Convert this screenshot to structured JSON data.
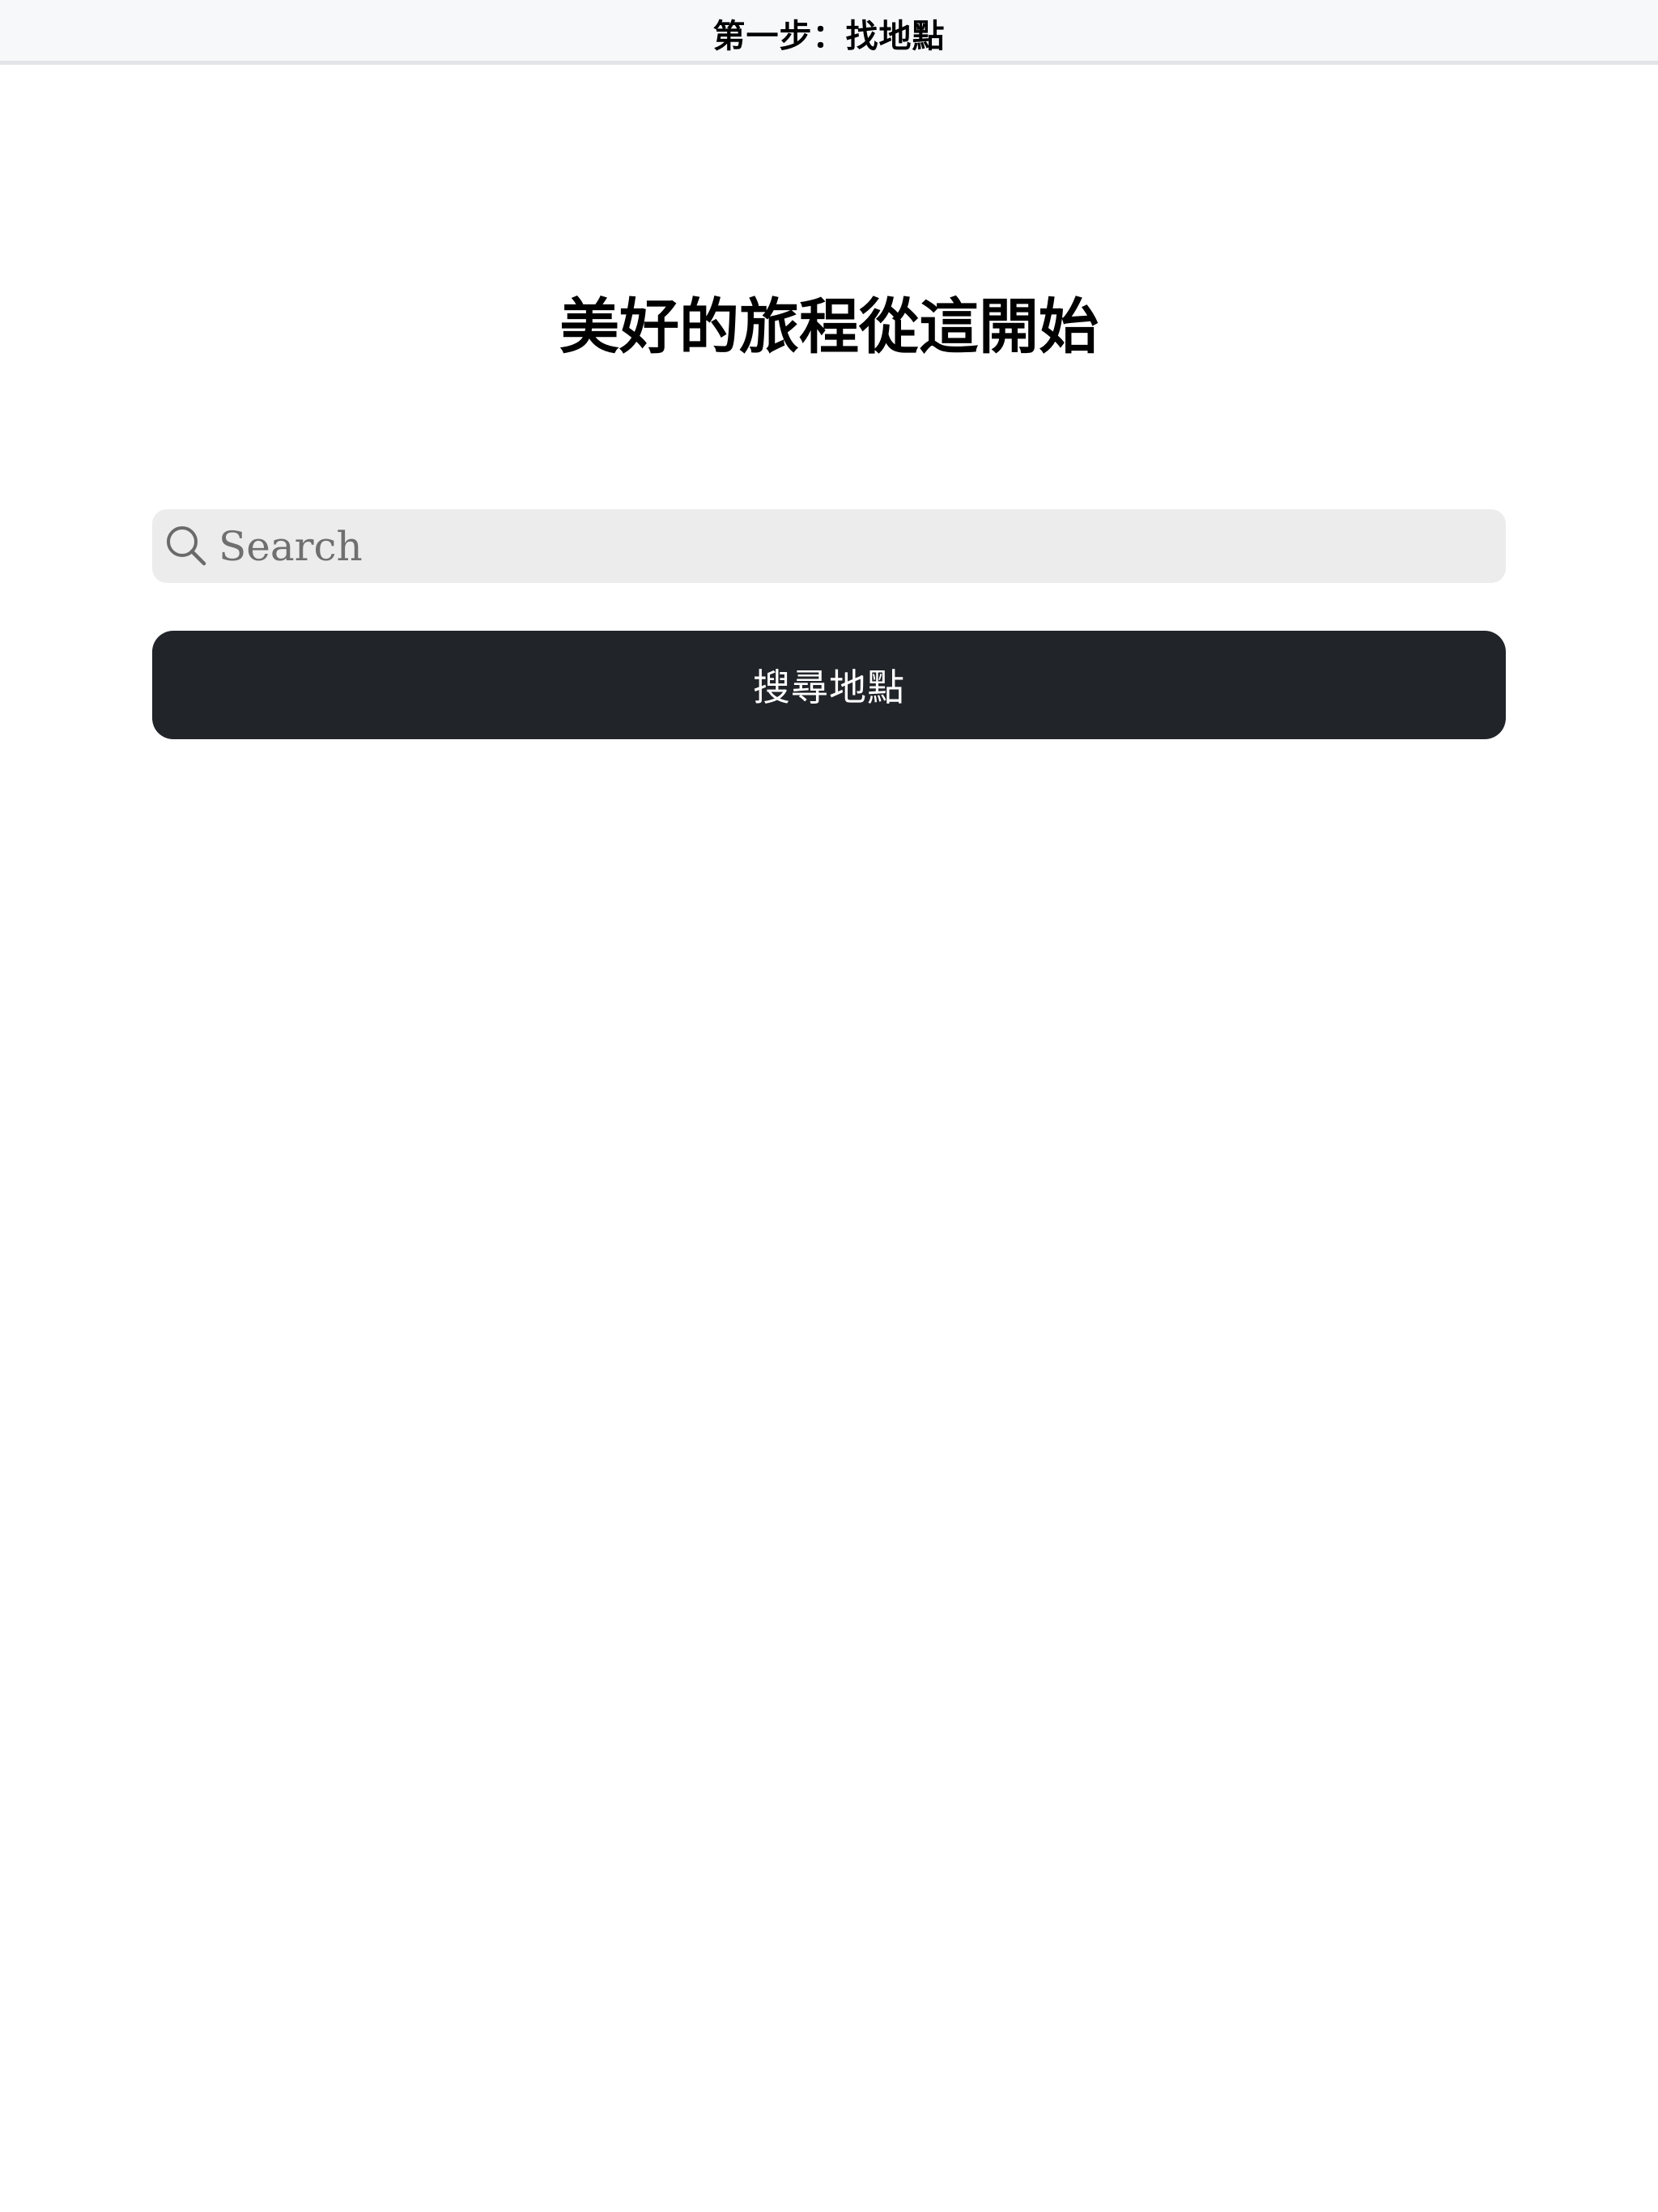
{
  "nav": {
    "title": "第一步：找地點"
  },
  "hero": {
    "heading": "美好的旅程從這開始"
  },
  "search": {
    "placeholder": "Search",
    "value": "",
    "icon": "search-icon"
  },
  "actions": {
    "search_button_label": "搜尋地點"
  },
  "colors": {
    "nav_background": "#f7f8fa",
    "search_background": "#ececec",
    "button_background": "#212429",
    "button_text": "#ffffff"
  }
}
